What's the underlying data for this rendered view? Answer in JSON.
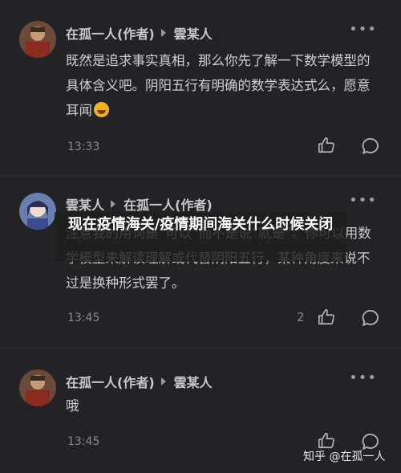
{
  "comments": [
    {
      "author": "在孤一人(作者)",
      "reply_to": "雲某人",
      "text": "既然是追求事实真相，那么你先了解一下数学模型的具体含义吧。阴阳五行有明确的数学表达式么，愿意耳闻",
      "emoji": "laughing-face",
      "time": "13:33",
      "likes": ""
    },
    {
      "author": "雲某人",
      "reply_to": "在孤一人(作者)",
      "text": "注意我的用词是“可以”而不是说“就是”。你可以用数学模型来解读理解或代替阴阳五行，某种角度来说不过是换种形式罢了。",
      "time": "13:45",
      "likes": "2"
    },
    {
      "author": "在孤一人(作者)",
      "reply_to": "雲某人",
      "text": "哦",
      "time": "13:45",
      "likes": ""
    }
  ],
  "more_label": "•••",
  "overlay_title": "现在疫情海关/疫情期间海关什么时候关闭",
  "watermark": "知乎 @在孤一人",
  "colors": {
    "background": "#232325",
    "divider": "#2b2b2d",
    "text": "#cfcfcf",
    "muted": "#8a8a8a"
  }
}
